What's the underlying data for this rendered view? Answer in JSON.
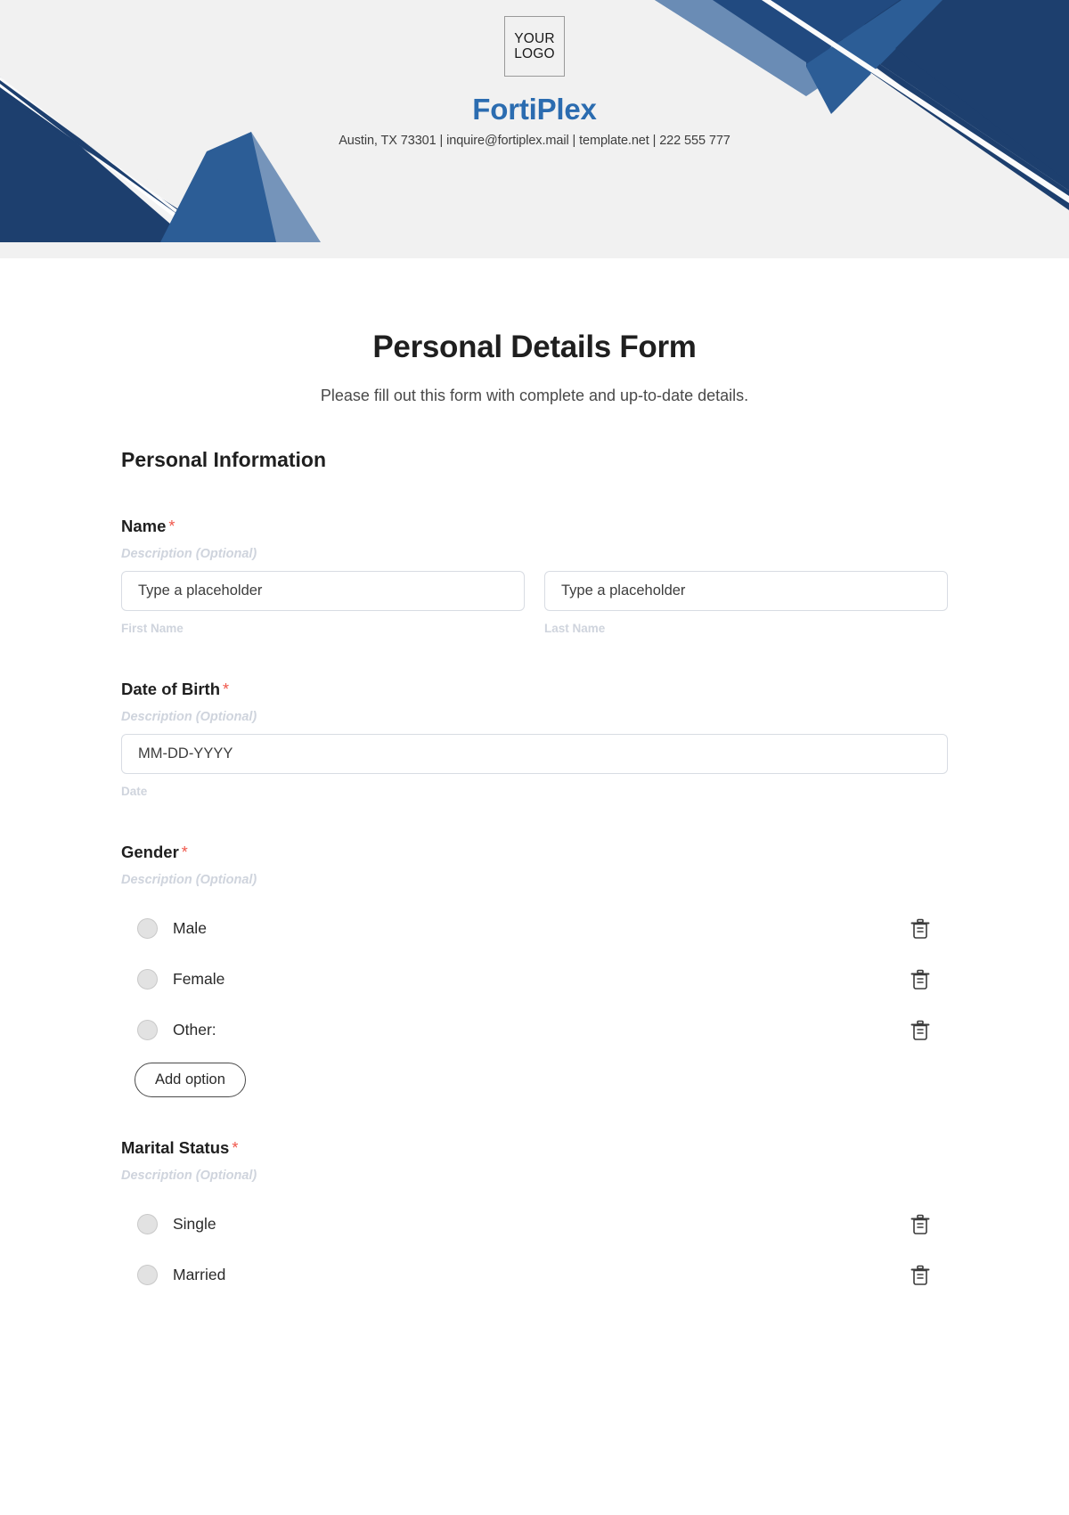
{
  "header": {
    "logo": {
      "line1": "YOUR",
      "line2": "LOGO"
    },
    "company_name": "FortiPlex",
    "contact_line": "Austin, TX 73301 | inquire@fortiplex.mail | template.net | 222 555 777",
    "colors": {
      "navy_dark": "#1d3f6e",
      "navy": "#214a80",
      "blue_mid": "#2c5d96",
      "blue_light": "#6a8cb5",
      "background": "#f1f1f1",
      "brand_blue": "#2b6cb0"
    }
  },
  "form": {
    "title": "Personal Details Form",
    "subtitle": "Please fill out this form with complete and up-to-date details.",
    "section_heading": "Personal Information",
    "required_marker": "*",
    "description_placeholder": "Description (Optional)",
    "add_option_label": "Add option",
    "fields": [
      {
        "label": "Name",
        "required": true,
        "description": "Description (Optional)",
        "inputs": [
          {
            "placeholder": "Type a placeholder",
            "value": "",
            "sub_label": "First Name"
          },
          {
            "placeholder": "Type a placeholder",
            "value": "",
            "sub_label": "Last Name"
          }
        ]
      },
      {
        "label": "Date of Birth",
        "required": true,
        "description": "Description (Optional)",
        "inputs": [
          {
            "placeholder": "MM-DD-YYYY",
            "value": "",
            "sub_label": "Date"
          }
        ]
      },
      {
        "label": "Gender",
        "required": true,
        "description": "Description (Optional)",
        "options": [
          "Male",
          "Female",
          "Other:"
        ],
        "has_add_option": true
      },
      {
        "label": "Marital Status",
        "required": true,
        "description": "Description (Optional)",
        "options": [
          "Single",
          "Married"
        ],
        "has_add_option": false
      }
    ]
  },
  "icons": {
    "delete": "trash-icon",
    "radio": "radio-button-icon"
  }
}
